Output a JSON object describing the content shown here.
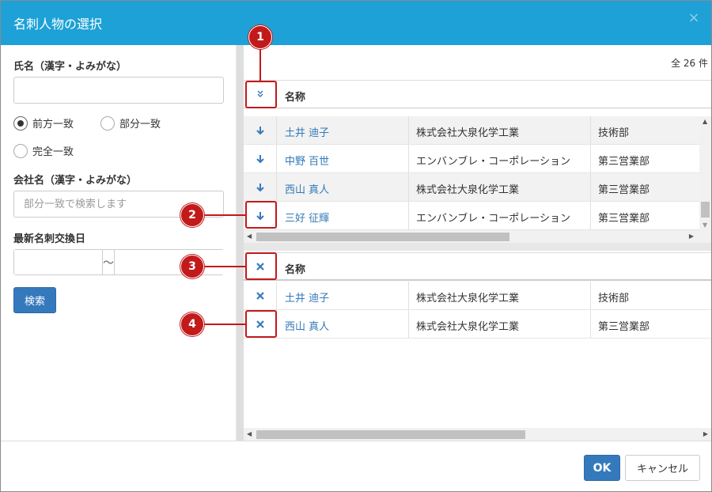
{
  "dialog": {
    "title": "名刺人物の選択",
    "close_glyph": "×"
  },
  "search": {
    "name_label": "氏名（漢字・よみがな）",
    "name_value": "",
    "match_options": [
      "前方一致",
      "部分一致",
      "完全一致"
    ],
    "match_selected": "前方一致",
    "company_label": "会社名（漢字・よみがな）",
    "company_placeholder": "部分一致で検索します",
    "date_label": "最新名刺交換日",
    "date_separator": "〜",
    "search_button": "検索"
  },
  "results": {
    "count_text": "全 26 件",
    "header_label": "名称",
    "rows": [
      {
        "name": "土井 迪子",
        "company": "株式会社大泉化学工業",
        "dept": "技術部"
      },
      {
        "name": "中野 百世",
        "company": "エンバンブレ・コーポレーション",
        "dept": "第三営業部"
      },
      {
        "name": "西山 真人",
        "company": "株式会社大泉化学工業",
        "dept": "第三営業部"
      },
      {
        "name": "三好 征輝",
        "company": "エンバンブレ・コーポレーション",
        "dept": "第三営業部"
      }
    ]
  },
  "selected": {
    "header_label": "名称",
    "rows": [
      {
        "name": "土井 迪子",
        "company": "株式会社大泉化学工業",
        "dept": "技術部"
      },
      {
        "name": "西山 真人",
        "company": "株式会社大泉化学工業",
        "dept": "第三営業部"
      }
    ]
  },
  "callouts": [
    "1",
    "2",
    "3",
    "4"
  ],
  "footer": {
    "ok_label": "OK",
    "cancel_label": "キャンセル"
  },
  "colors": {
    "titlebar": "#1da1d6",
    "primary": "#3579bd",
    "link": "#337ab7",
    "callout": "#c21a1a"
  },
  "icons": {
    "add_all": "double-chevron-down-icon",
    "add": "arrow-down-icon",
    "remove": "x-icon"
  }
}
